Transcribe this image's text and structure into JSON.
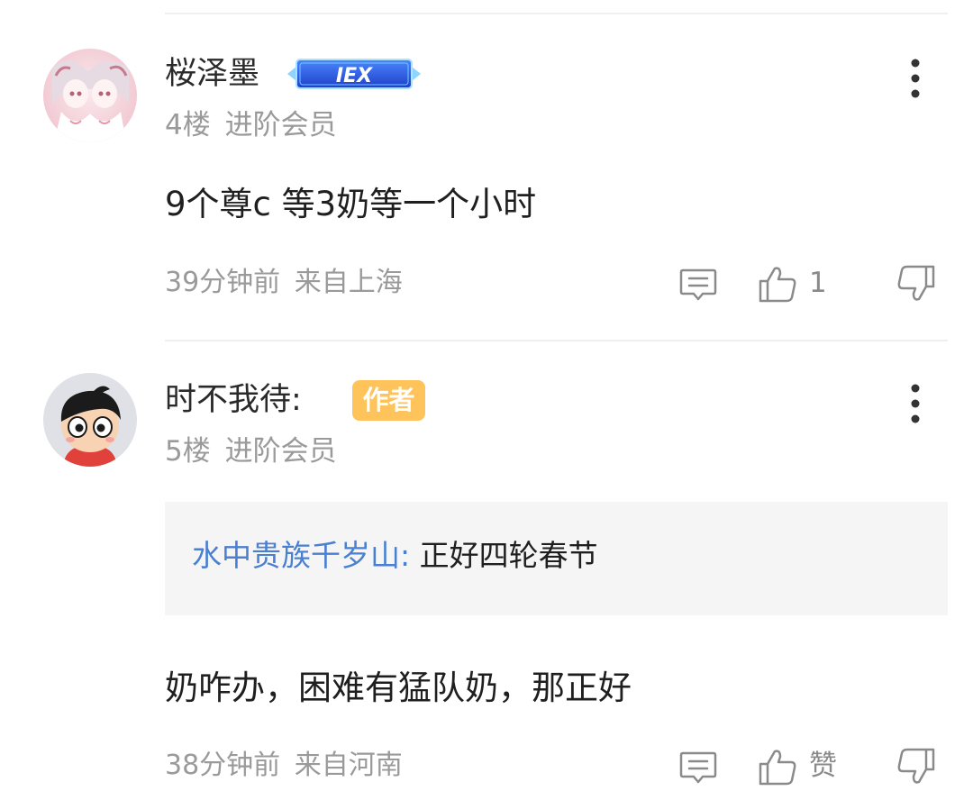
{
  "comments": [
    {
      "username": "桜泽墨",
      "level_badge": "IEX",
      "floor": "4楼",
      "member_label": "进阶会员",
      "text": "9个尊c  等3奶等一个小时",
      "time": "39分钟前",
      "location": "来自上海",
      "like_count": "1"
    },
    {
      "username": "时不我待:",
      "author_badge": "作者",
      "floor": "5楼",
      "member_label": "进阶会员",
      "quote": {
        "user": "水中贵族千岁山",
        "separator": ": ",
        "text": "正好四轮春节"
      },
      "text": "奶咋办，困难有猛队奶，那正好",
      "time": "38分钟前",
      "location": "来自河南",
      "like_label": "赞"
    }
  ],
  "colors": {
    "quote_user": "#4a7fd1",
    "author_badge_bg": "#ffc35c",
    "meta_text": "#9a9a9a",
    "quote_bg": "#f5f5f5"
  }
}
